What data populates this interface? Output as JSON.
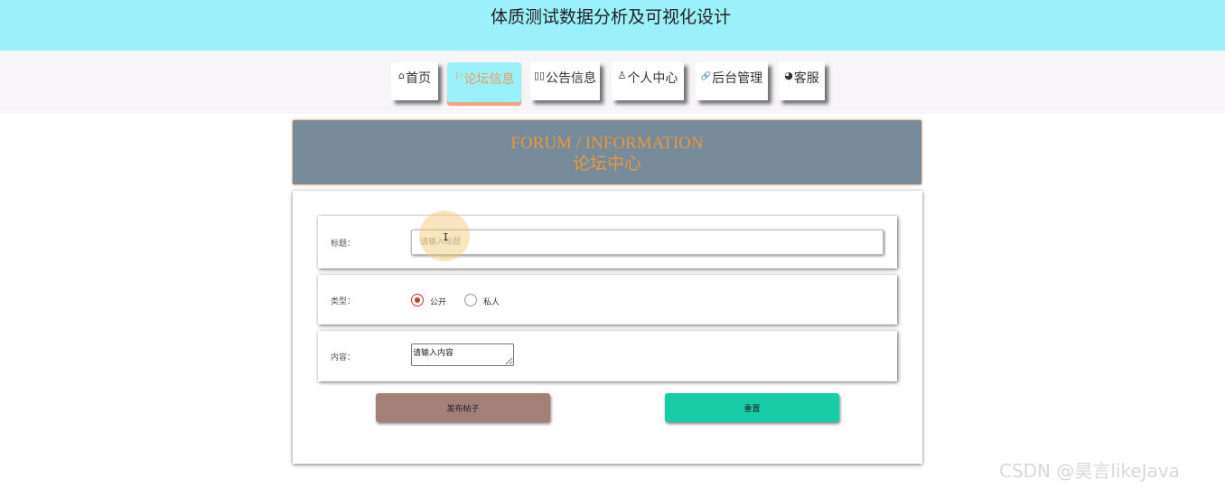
{
  "app": {
    "title": "体质测试数据分析及可视化设计"
  },
  "nav": {
    "items": [
      {
        "icon": "⌂",
        "icon_name": "home-icon",
        "label": "首页"
      },
      {
        "icon": "⚐",
        "icon_name": "flag-icon",
        "label": "论坛信息",
        "active": true
      },
      {
        "icon": "▯▯",
        "icon_name": "notice-icon",
        "label": "公告信息"
      },
      {
        "icon": "♙",
        "icon_name": "user-icon",
        "label": "个人中心"
      },
      {
        "icon": "🔗",
        "icon_name": "link-icon",
        "label": "后台管理"
      },
      {
        "icon": "◕",
        "icon_name": "support-icon",
        "label": "客服"
      }
    ]
  },
  "header": {
    "english": "FORUM / INFORMATION",
    "chinese": "论坛中心"
  },
  "form": {
    "title_label": "标题：",
    "title_placeholder": "请输入标题",
    "type_label": "类型：",
    "type_options": [
      "公开",
      "私人"
    ],
    "type_selected": "公开",
    "content_label": "内容：",
    "content_value": "请输入内容",
    "publish_button": "发布帖子",
    "reset_button": "重置"
  },
  "watermark": "CSDN @昊言likeJava",
  "colors": {
    "banner": "#9af1fc",
    "nav_active_bg": "#9af1fc",
    "nav_active_text": "#e89a6b",
    "header_bg": "#778a9a",
    "header_text": "#e8993f",
    "publish_button": "#a28075",
    "reset_button": "#19cca8"
  }
}
